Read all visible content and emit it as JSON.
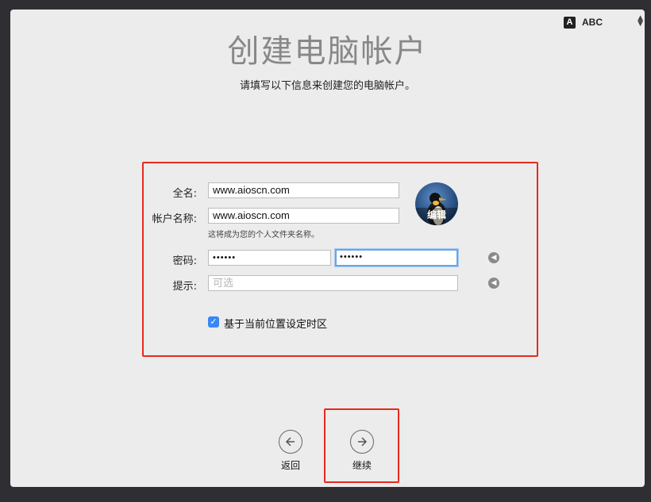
{
  "input_method": {
    "badge": "A",
    "label": "ABC"
  },
  "header": {
    "title": "创建电脑帐户",
    "subtitle": "请填写以下信息来创建您的电脑帐户。"
  },
  "form": {
    "full_name": {
      "label": "全名:",
      "value": "www.aioscn.com"
    },
    "account_name": {
      "label": "帐户名称:",
      "value": "www.aioscn.com",
      "hint": "这将成为您的个人文件夹名称。"
    },
    "password": {
      "label": "密码:",
      "value": "••••••",
      "verify_value": "••••••"
    },
    "hint_field": {
      "label": "提示:",
      "placeholder": "可选"
    },
    "timezone_checkbox": {
      "label": "基于当前位置设定时区",
      "checked": true
    }
  },
  "avatar": {
    "edit_label": "编辑"
  },
  "nav": {
    "back_label": "返回",
    "continue_label": "继续"
  },
  "colors": {
    "highlight": "#e8291f",
    "accent": "#3b86f5"
  }
}
